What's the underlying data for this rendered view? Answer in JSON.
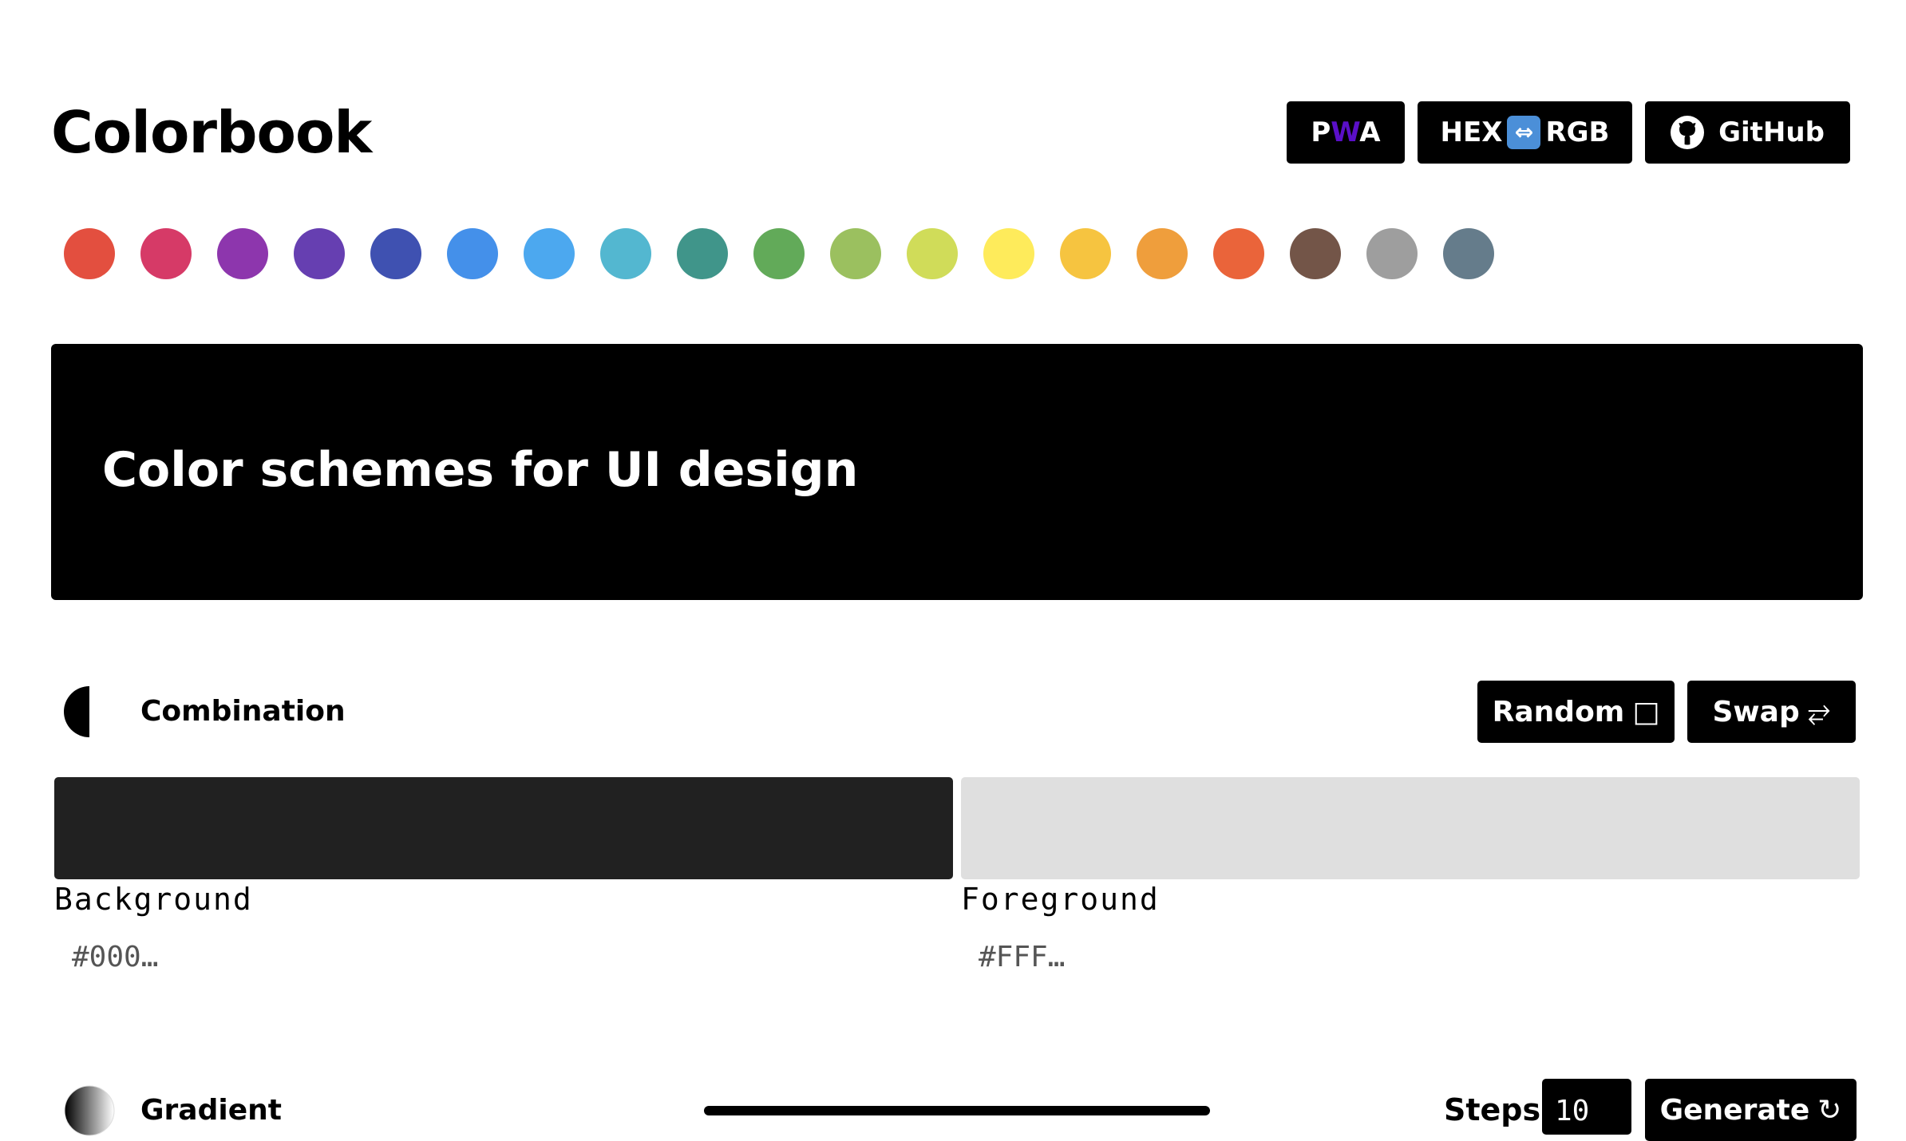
{
  "header": {
    "title": "Colorbook",
    "buttons": {
      "pwa_p": "P",
      "pwa_w": "W",
      "pwa_a": "A",
      "hex_label": "HEX",
      "arrow_icon": "left-right-arrow-icon",
      "rgb_label": "RGB",
      "github_label": "GitHub",
      "github_icon": "github-icon"
    }
  },
  "palette": {
    "swatches": [
      "#E34F3F",
      "#D63A67",
      "#8D36AD",
      "#663FB1",
      "#3F51B1",
      "#4490EA",
      "#4CA8EF",
      "#53B7D0",
      "#40958A",
      "#62AA59",
      "#9BC05F",
      "#D0DC59",
      "#FEEB5B",
      "#F6C440",
      "#EF9E3C",
      "#EA643A",
      "#735548",
      "#9E9E9E",
      "#657C8B"
    ]
  },
  "hero": {
    "text": "Color schemes for UI design"
  },
  "combination": {
    "title": "Combination",
    "random_label": "Random",
    "random_icon": "□",
    "swap_label": "Swap",
    "swap_icon": "⥂",
    "background": {
      "label": "Background",
      "color": "#212121",
      "placeholder": "#000…"
    },
    "foreground": {
      "label": "Foreground",
      "color": "#DFDFDF",
      "placeholder": "#FFF…"
    }
  },
  "gradient": {
    "title": "Gradient",
    "steps_label": "Steps:",
    "steps_value": "10",
    "generate_label": "Generate",
    "generate_icon": "↻"
  }
}
